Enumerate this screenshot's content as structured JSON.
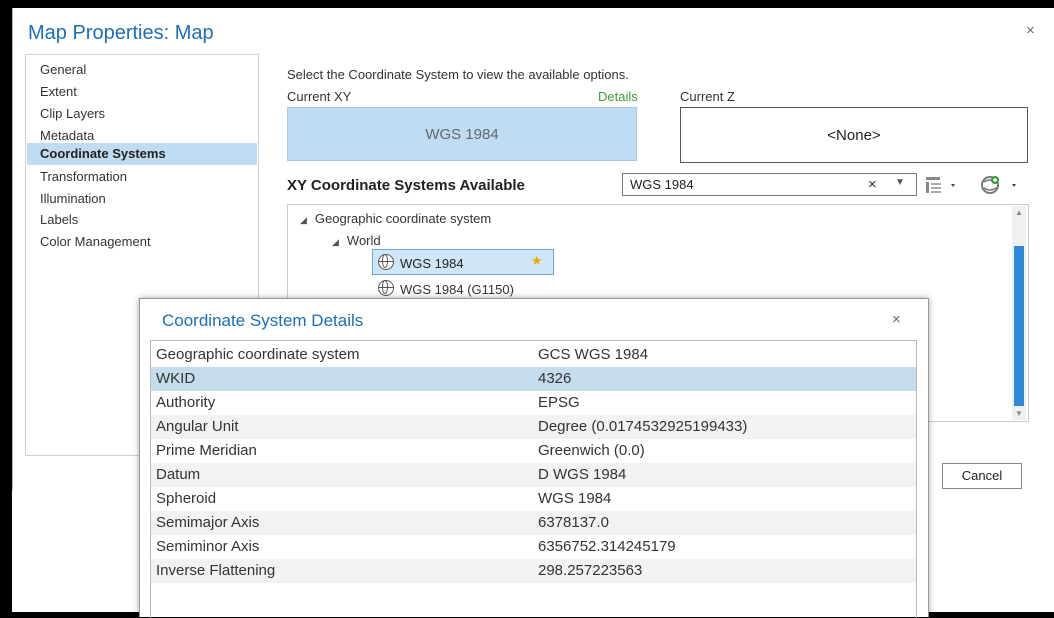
{
  "dialog": {
    "title": "Map Properties: Map",
    "close": "×",
    "cancel_label": "Cancel"
  },
  "nav": {
    "items": [
      {
        "label": "General"
      },
      {
        "label": "Extent"
      },
      {
        "label": "Clip Layers"
      },
      {
        "label": "Metadata"
      },
      {
        "label": "Coordinate Systems",
        "selected": true
      },
      {
        "label": "Transformation"
      },
      {
        "label": "Illumination"
      },
      {
        "label": "Labels"
      },
      {
        "label": "Color Management"
      }
    ]
  },
  "coord": {
    "instruction": "Select the Coordinate System to view the available options.",
    "current_xy_label": "Current XY",
    "details_link": "Details",
    "current_z_label": "Current Z",
    "current_xy_value": "WGS 1984",
    "current_z_value": "<None>",
    "available_title": "XY Coordinate Systems Available",
    "search_value": "WGS 1984",
    "search_clear": "×",
    "tree": {
      "root": "Geographic coordinate system",
      "child": "World",
      "items": [
        "WGS 1984",
        "WGS 1984 (G1150)"
      ]
    }
  },
  "details": {
    "title": "Coordinate System Details",
    "close": "×",
    "rows": [
      {
        "key": "Geographic coordinate system",
        "value": "GCS WGS 1984"
      },
      {
        "key": "WKID",
        "value": "4326"
      },
      {
        "key": "Authority",
        "value": "EPSG"
      },
      {
        "key": "Angular Unit",
        "value": "Degree (0.0174532925199433)"
      },
      {
        "key": "Prime Meridian",
        "value": "Greenwich (0.0)"
      },
      {
        "key": "Datum",
        "value": "D WGS 1984"
      },
      {
        "key": "Spheroid",
        "value": "WGS 1984"
      },
      {
        "key": "Semimajor Axis",
        "value": "6378137.0"
      },
      {
        "key": "Semiminor Axis",
        "value": "6356752.314245179"
      },
      {
        "key": "Inverse Flattening",
        "value": "298.257223563"
      }
    ]
  },
  "colors": {
    "title_blue": "#1b6fb8",
    "selection_blue": "#bfdcf2",
    "link_green": "#3b9a3b",
    "scroll_blue": "#2e8ad8"
  }
}
